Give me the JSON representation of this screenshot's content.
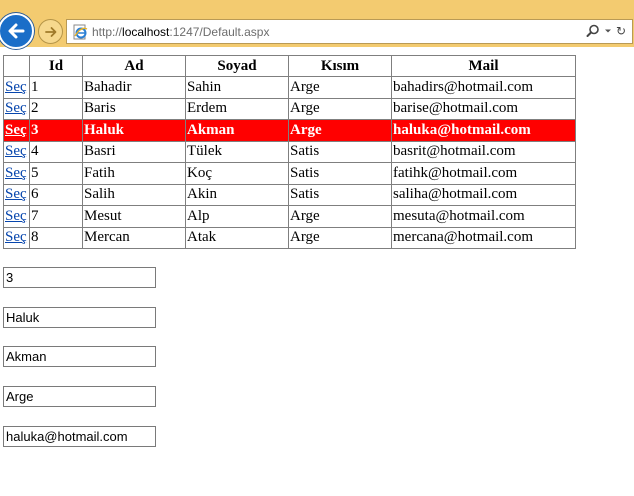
{
  "browser": {
    "url_scheme": "http://",
    "url_host": "localhost",
    "url_path": ":1247/Default.aspx",
    "icons": {
      "back": "arrow-left-icon",
      "forward": "arrow-right-icon",
      "page": "ie-page-icon",
      "search": "search-icon",
      "dropdown": "chevron-down-icon",
      "refresh": "refresh-icon"
    }
  },
  "grid": {
    "headers": {
      "select": "",
      "id": "Id",
      "ad": "Ad",
      "soyad": "Soyad",
      "kisim": "Kısım",
      "mail": "Mail"
    },
    "select_label": "Seç",
    "selected_color": "#ff0000",
    "rows": [
      {
        "id": "1",
        "ad": "Bahadir",
        "soyad": "Sahin",
        "kisim": "Arge",
        "mail": "bahadirs@hotmail.com"
      },
      {
        "id": "2",
        "ad": "Baris",
        "soyad": "Erdem",
        "kisim": "Arge",
        "mail": "barise@hotmail.com"
      },
      {
        "id": "3",
        "ad": "Haluk",
        "soyad": "Akman",
        "kisim": "Arge",
        "mail": "haluka@hotmail.com"
      },
      {
        "id": "4",
        "ad": "Basri",
        "soyad": "Tülek",
        "kisim": "Satis",
        "mail": "basrit@hotmail.com"
      },
      {
        "id": "5",
        "ad": "Fatih",
        "soyad": "Koç",
        "kisim": "Satis",
        "mail": "fatihk@hotmail.com"
      },
      {
        "id": "6",
        "ad": "Salih",
        "soyad": "Akin",
        "kisim": "Satis",
        "mail": "saliha@hotmail.com"
      },
      {
        "id": "7",
        "ad": "Mesut",
        "soyad": "Alp",
        "kisim": "Arge",
        "mail": "mesuta@hotmail.com"
      },
      {
        "id": "8",
        "ad": "Mercan",
        "soyad": "Atak",
        "kisim": "Arge",
        "mail": "mercana@hotmail.com"
      }
    ]
  },
  "form": {
    "id_value": "3",
    "ad_value": "Haluk",
    "soyad_value": "Akman",
    "kisim_value": "Arge",
    "mail_value": "haluka@hotmail.com"
  }
}
